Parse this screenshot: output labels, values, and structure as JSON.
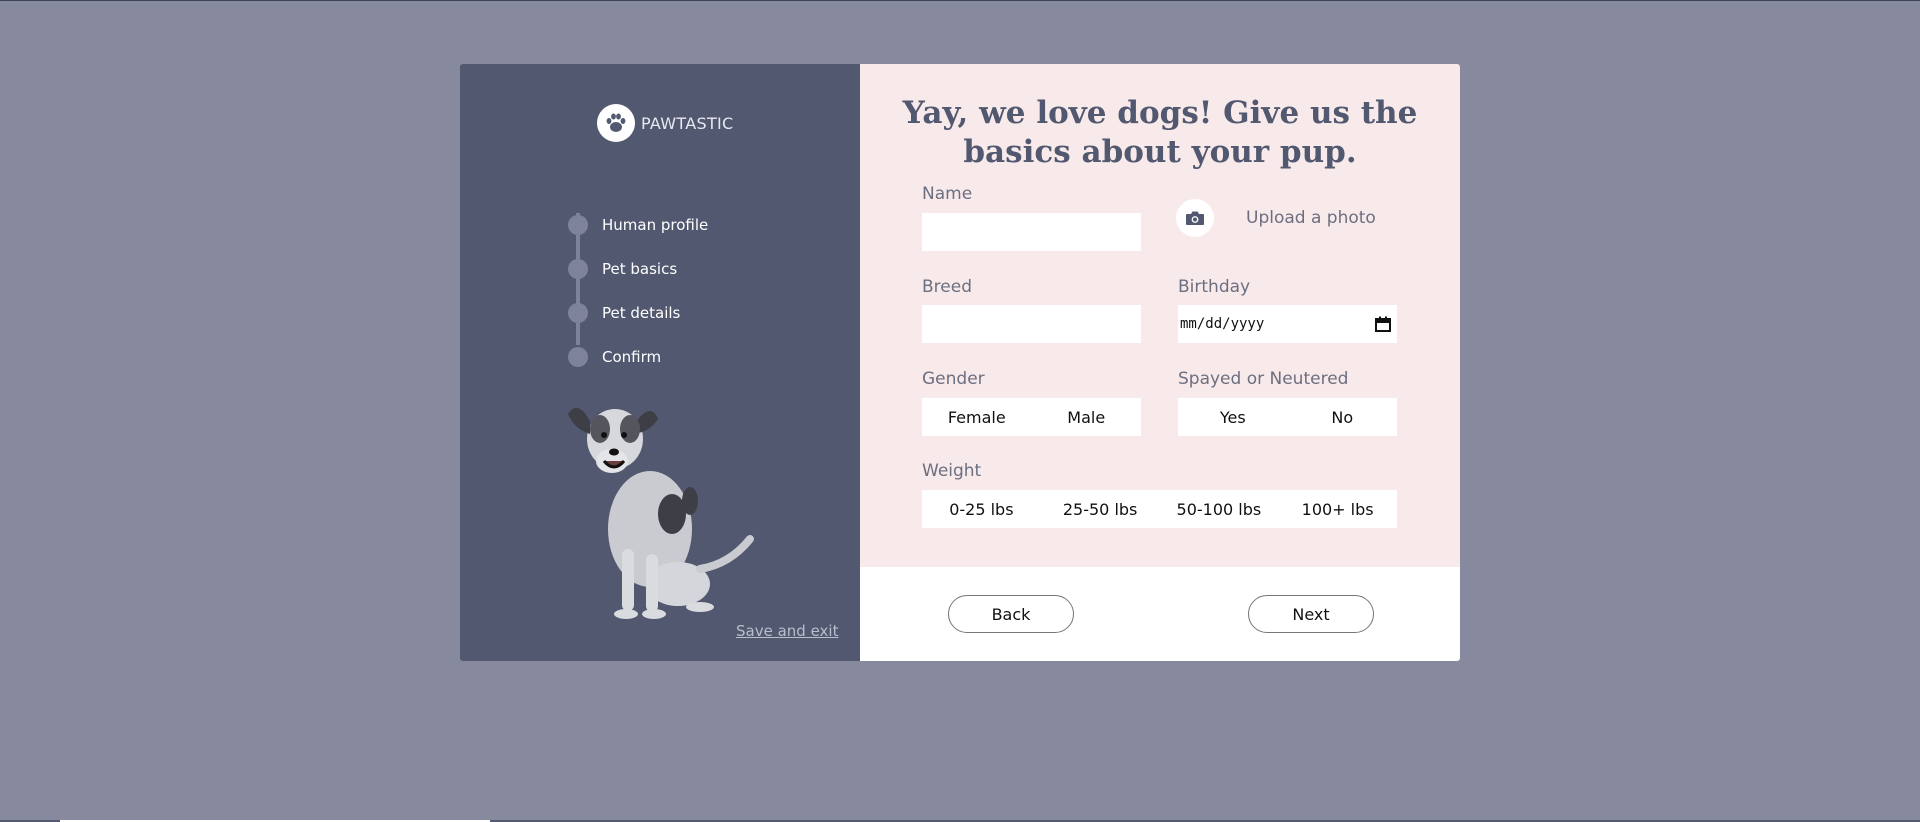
{
  "brand": {
    "name": "PAWTASTIC",
    "logo_icon": "paw-icon"
  },
  "steps": [
    {
      "label": "Human profile"
    },
    {
      "label": "Pet basics"
    },
    {
      "label": "Pet details"
    },
    {
      "label": "Confirm"
    }
  ],
  "save_exit_label": "Save and exit",
  "form": {
    "title_line1": "Yay, we love dogs! Give us the",
    "title_line2": "basics about your pup.",
    "name_label": "Name",
    "name_value": "",
    "upload_label": "Upload a photo",
    "upload_icon": "camera-icon",
    "breed_label": "Breed",
    "breed_value": "",
    "birthday_label": "Birthday",
    "birthday_placeholder": "mm/dd/yyyy",
    "gender_label": "Gender",
    "gender_options": [
      "Female",
      "Male"
    ],
    "spayed_label": "Spayed or Neutered",
    "spayed_options": [
      "Yes",
      "No"
    ],
    "weight_label": "Weight",
    "weight_options": [
      "0-25 lbs",
      "25-50 lbs",
      "50-100 lbs",
      "100+ lbs"
    ]
  },
  "nav": {
    "back_label": "Back",
    "next_label": "Next"
  },
  "colors": {
    "background": "#878a9e",
    "sidebar": "#52586f",
    "form_bg": "#f8eaea",
    "accent": "#52586f"
  }
}
